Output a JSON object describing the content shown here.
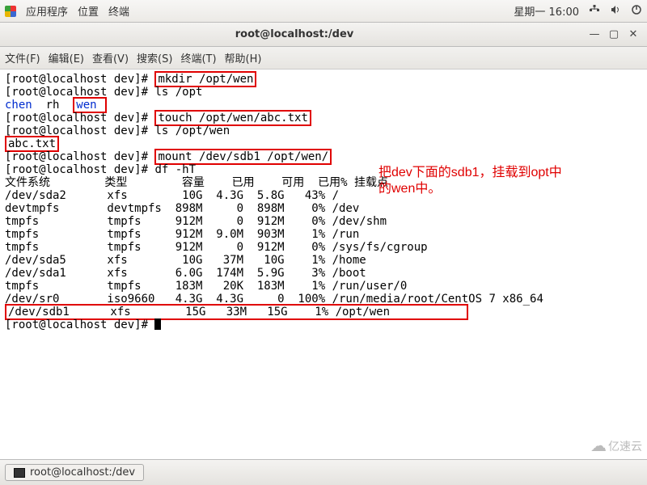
{
  "topbar": {
    "menus": [
      "应用程序",
      "位置",
      "终端"
    ],
    "clock": "星期一 16:00",
    "icons": [
      "network-icon",
      "volume-icon",
      "power-icon"
    ]
  },
  "window": {
    "title": "root@localhost:/dev"
  },
  "menubar": {
    "items": [
      "文件(F)",
      "编辑(E)",
      "查看(V)",
      "搜索(S)",
      "终端(T)",
      "帮助(H)"
    ]
  },
  "prompt": {
    "p1": "[root@localhost dev]# ",
    "cmd_mkdir": "mkdir /opt/wen",
    "cmd_lsopt": "ls /opt",
    "ls_opt_chen": "chen",
    "ls_opt_rh": "  rh  ",
    "ls_opt_wen": "wen ",
    "cmd_touch": "touch /opt/wen/abc.txt",
    "cmd_lswen": "ls /opt/wen",
    "ls_wen_abc": "abc.txt",
    "cmd_mount": "mount /dev/sdb1 /opt/wen/",
    "cmd_df": "df -hT"
  },
  "annotation": {
    "line1": "把dev下面的sdb1，挂载到opt中",
    "line2": "的wen中。"
  },
  "df": {
    "header": "文件系统        类型        容量    已用    可用  已用% 挂载点",
    "rows": [
      "/dev/sda2      xfs        10G  4.3G  5.8G   43% /",
      "devtmpfs       devtmpfs  898M     0  898M    0% /dev",
      "tmpfs          tmpfs     912M     0  912M    0% /dev/shm",
      "tmpfs          tmpfs     912M  9.0M  903M    1% /run",
      "tmpfs          tmpfs     912M     0  912M    0% /sys/fs/cgroup",
      "/dev/sda5      xfs        10G   37M   10G    1% /home",
      "/dev/sda1      xfs       6.0G  174M  5.9G    3% /boot",
      "tmpfs          tmpfs     183M   20K  183M    1% /run/user/0",
      "/dev/sr0       iso9660   4.3G  4.3G     0  100% /run/media/root/CentOS 7 x86_64"
    ],
    "hl_row": "/dev/sdb1      xfs        15G   33M   15G    1% /opt/wen           "
  },
  "taskbar": {
    "item": "root@localhost:/dev"
  },
  "watermark": "亿速云"
}
